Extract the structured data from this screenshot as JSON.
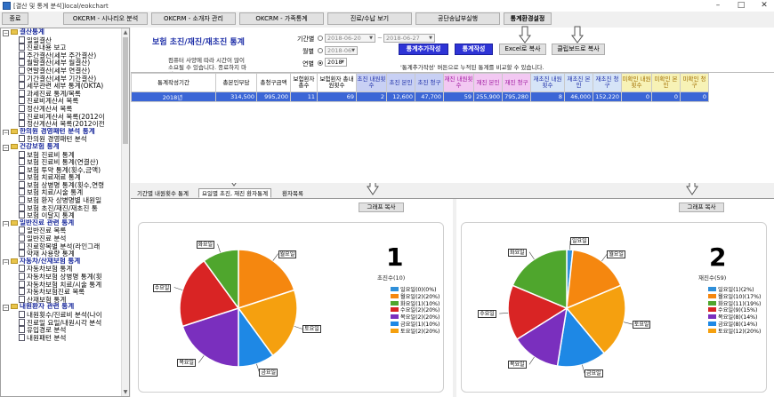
{
  "window": {
    "title": "[결산 및 통계 분석]local/eokchart",
    "controls": [
      "–",
      "□",
      "✕"
    ]
  },
  "toolbar": {
    "buttons": [
      "종료",
      "OKCRM - 시나리오 분석",
      "OKCRM - 소개자 관리",
      "OKCRM - 가족통계",
      "진료/수납 보기",
      "공단송납부실행",
      "통계환경설정"
    ]
  },
  "tree": {
    "rows": [
      {
        "t": "g",
        "label": "결산통계"
      },
      {
        "t": "c",
        "label": "일일결산"
      },
      {
        "t": "c",
        "label": "진료내용 보고"
      },
      {
        "t": "c",
        "label": "주간결산(세부 주간결산)"
      },
      {
        "t": "c",
        "label": "월말결산(세부 월결산)"
      },
      {
        "t": "c",
        "label": "연말결산(세부 연결산)"
      },
      {
        "t": "c",
        "label": "기간결산(세부 기간결산)"
      },
      {
        "t": "c",
        "label": "세무관련 세부 통계(OKTA)"
      },
      {
        "t": "c",
        "label": "과세진료 통계/목록"
      },
      {
        "t": "c",
        "label": "진료비계산서 목록"
      },
      {
        "t": "c",
        "label": "정산계산서 목록"
      },
      {
        "t": "c",
        "label": "진료비계산서 목록(2012이"
      },
      {
        "t": "c",
        "label": "정산계산서 목록(2012이전"
      },
      {
        "t": "g",
        "label": "한의원 경영패턴 분석 통계"
      },
      {
        "t": "c",
        "label": "한의원 경영패턴 분석"
      },
      {
        "t": "g",
        "label": "건강보험 통계"
      },
      {
        "t": "c",
        "label": "보험 진료비 통계"
      },
      {
        "t": "c",
        "label": "보험 진료비 통계(연결산)"
      },
      {
        "t": "c",
        "label": "보험 투약 통계(횟수,금액)"
      },
      {
        "t": "c",
        "label": "보험 치료재료 통계"
      },
      {
        "t": "c",
        "label": "보험 상병명 통계(횟수,연령"
      },
      {
        "t": "c",
        "label": "보험 치료/시술 통계"
      },
      {
        "t": "c",
        "label": "보험 환자 상병명별 내원일"
      },
      {
        "t": "c",
        "label": "보험 초진/재진/재초진 통"
      },
      {
        "t": "c",
        "label": "보험 이달지 통계"
      },
      {
        "t": "g",
        "label": "일반진료 관련 통계"
      },
      {
        "t": "c",
        "label": "일반진료 목록"
      },
      {
        "t": "c",
        "label": "일반진료 분석"
      },
      {
        "t": "c",
        "label": "진료항목별 분석(라인그래"
      },
      {
        "t": "c",
        "label": "약재 사용량 통계"
      },
      {
        "t": "g",
        "label": "자동차/산재보험 통계"
      },
      {
        "t": "c",
        "label": "자동차보험 통계"
      },
      {
        "t": "c",
        "label": "자동차보험 상병명 통계(횟"
      },
      {
        "t": "c",
        "label": "자동차보험 치료/시술 통계"
      },
      {
        "t": "c",
        "label": "자동차보험진료 목록"
      },
      {
        "t": "c",
        "label": "산재보험 통계"
      },
      {
        "t": "g",
        "label": "내원환자 관련 통계"
      },
      {
        "t": "c",
        "label": "내원횟수/진료비 분석(나이"
      },
      {
        "t": "c",
        "label": "진료일 요일/내원시각 분석"
      },
      {
        "t": "c",
        "label": "유입경로 분석"
      },
      {
        "t": "c",
        "label": "내원패턴 분석"
      }
    ]
  },
  "header": {
    "title": "보험 초진/재진/재초진 통계",
    "note": "컴퓨터 사양에 따라 시간이 많이 소요될 수 있습니다. 종료하지 마십시오.",
    "period_label": "기간별",
    "monthly_label": "월별",
    "yearly_label": "연별",
    "date_from": "2018-06-20",
    "date_sep": "~",
    "date_to": "2018-06-27",
    "month_value": "2018-06",
    "year_value": "2018",
    "btn_add": "통계추가작성",
    "btn_create": "통계작성",
    "btn_excel": "Excel로 복사",
    "btn_clip": "클립보드로 복사",
    "compare_note": "'통계추가작성' 버튼으로 누적된 통계를 비교할 수 있습니다."
  },
  "grid": {
    "columns": [
      "통계작성기간",
      "총본인부담",
      "총청구금액",
      "보험환자 총수",
      "보험환자 총내원횟수",
      "초진 내원횟수",
      "초진 본인",
      "초진 청구",
      "재진 내원횟수",
      "재진 본인",
      "재진 청구",
      "재초진 내원횟수",
      "재초진 본인",
      "재초진 청구",
      "미확인 내원횟수",
      "미확인 본인",
      "미확인 청구"
    ],
    "rows": [
      [
        "2018년",
        "314,500",
        "995,200",
        "11",
        "69",
        "2",
        "12,600",
        "47,700",
        "59",
        "255,900",
        "795,280",
        "8",
        "46,000",
        "152,220",
        "0",
        "0",
        "0"
      ]
    ]
  },
  "tabs": [
    "기간별 내원횟수 통계",
    "요일별 초진, 재진 환자통계",
    "환자목록"
  ],
  "charts": {
    "copy_label": "그래프 복사",
    "left": {
      "number": "1",
      "subtitle": "초진수(10)",
      "legend": [
        "일요일(0)(0%)",
        "월요일(2)(20%)",
        "화요일(1)(10%)",
        "수요일(2)(20%)",
        "목요일(2)(20%)",
        "금요일(1)(10%)",
        "토요일(2)(20%)"
      ],
      "slice_labels": [
        "화요일",
        "월요일",
        "토요일",
        "금요일",
        "목요일",
        "수요일"
      ]
    },
    "right": {
      "number": "2",
      "subtitle": "재진수(59)",
      "legend": [
        "일요일(1)(2%)",
        "월요일(10)(17%)",
        "화요일(11)(19%)",
        "수요일(9)(15%)",
        "목요일(8)(14%)",
        "금요일(8)(14%)",
        "토요일(12)(20%)"
      ],
      "slice_labels": [
        "화요일",
        "월요일",
        "일요일",
        "토요일",
        "금요일",
        "목요일",
        "수요일"
      ]
    }
  },
  "chart_data": [
    {
      "type": "pie",
      "title": "1",
      "subtitle": "초진수(10)",
      "categories": [
        "일요일",
        "월요일",
        "화요일",
        "수요일",
        "목요일",
        "금요일",
        "토요일"
      ],
      "values": [
        0,
        2,
        1,
        2,
        2,
        1,
        2
      ],
      "colors": [
        "#2f8fd9",
        "#f5870f",
        "#4fa62d",
        "#d92424",
        "#7a2fbe",
        "#1e88e5",
        "#f5a00f"
      ]
    },
    {
      "type": "pie",
      "title": "2",
      "subtitle": "재진수(59)",
      "categories": [
        "일요일",
        "월요일",
        "화요일",
        "수요일",
        "목요일",
        "금요일",
        "토요일"
      ],
      "values": [
        1,
        10,
        11,
        9,
        8,
        8,
        12
      ],
      "colors": [
        "#2f8fd9",
        "#f5870f",
        "#4fa62d",
        "#d92424",
        "#7a2fbe",
        "#1e88e5",
        "#f5a00f"
      ]
    }
  ],
  "colors": {
    "sun": "#2f8fd9",
    "mon": "#f5870f",
    "tue": "#4fa62d",
    "wed": "#d92424",
    "thu": "#7a2fbe",
    "fri": "#1e88e5",
    "sat": "#f5a00f"
  }
}
